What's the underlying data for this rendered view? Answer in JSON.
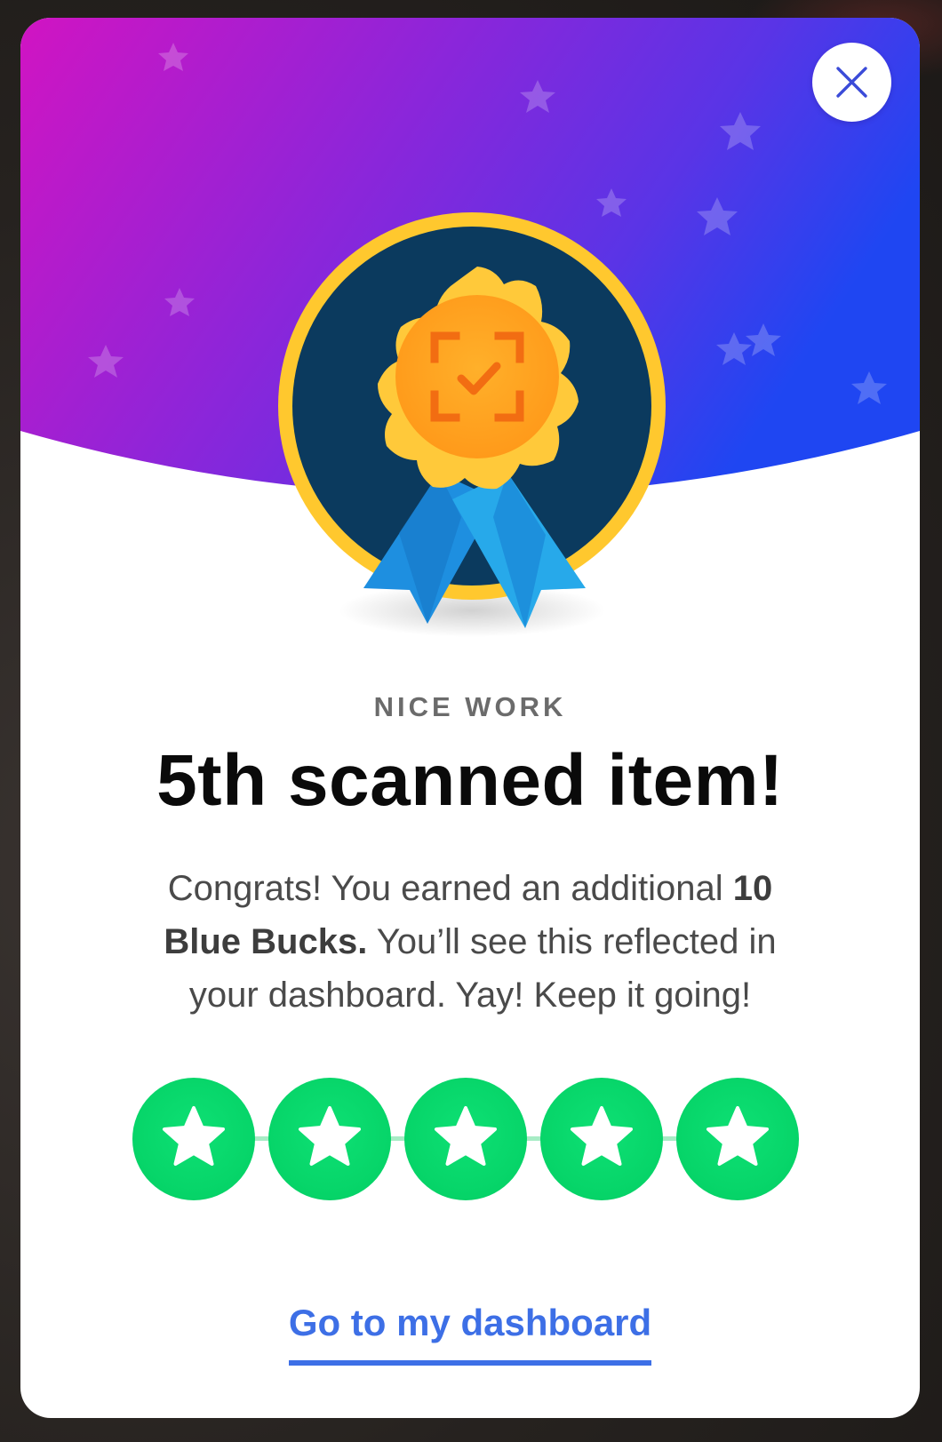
{
  "modal": {
    "eyebrow": "NICE WORK",
    "title": "5th scanned item!",
    "body_prefix": "Congrats! You earned an additional ",
    "body_bold": "10 Blue Bucks.",
    "body_suffix": " You’ll see this reflected in your dashboard. Yay! Keep it going!",
    "cta_label": "Go to my dashboard"
  },
  "progress": {
    "completed": 5,
    "total": 5,
    "step_icon": "star-icon"
  },
  "icons": {
    "close": "close-icon",
    "badge": "medal-badge-icon",
    "scan": "scan-check-icon"
  },
  "colors": {
    "hero_gradient_start": "#d114c2",
    "hero_gradient_mid": "#7a2ee0",
    "hero_gradient_end": "#2244ee",
    "medal_gold": "#ffc82e",
    "medal_navy": "#0b3a5e",
    "ribbon_blue": "#1e8fe0",
    "step_green": "#06d468",
    "link_blue": "#3d6fe6"
  }
}
